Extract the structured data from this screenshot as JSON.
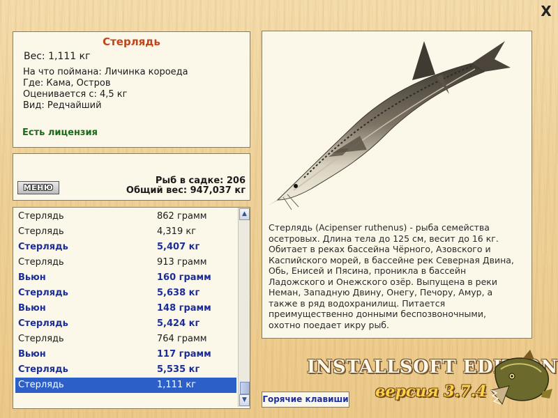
{
  "window": {
    "close_glyph": "X"
  },
  "info": {
    "title": "Стерлядь",
    "weight": "Вес: 1,111 кг",
    "caught_on": "На что поймана: Личинка короеда",
    "location": "Где: Кама, Остров",
    "rated_from": "Оценивается с: 4,5 кг",
    "species_status": "Вид: Редчайший",
    "license": "Есть лицензия"
  },
  "stats": {
    "menu_label": "МЕНЮ",
    "fish_count": "Рыб в садке: 206",
    "total_weight": "Общий вес: 947,037 кг"
  },
  "catch_list": [
    {
      "name": "Стерлядь",
      "weight": "862 грамм",
      "highlight": false
    },
    {
      "name": "Стерлядь",
      "weight": "4,319 кг",
      "highlight": false
    },
    {
      "name": "Стерлядь",
      "weight": "5,407 кг",
      "highlight": true
    },
    {
      "name": "Стерлядь",
      "weight": "913 грамм",
      "highlight": false
    },
    {
      "name": "Вьюн",
      "weight": "160 грамм",
      "highlight": true
    },
    {
      "name": "Стерлядь",
      "weight": "5,638 кг",
      "highlight": true
    },
    {
      "name": "Вьюн",
      "weight": "148 грамм",
      "highlight": true
    },
    {
      "name": "Стерлядь",
      "weight": "5,424 кг",
      "highlight": true
    },
    {
      "name": "Стерлядь",
      "weight": "764 грамм",
      "highlight": false
    },
    {
      "name": "Вьюн",
      "weight": "117 грамм",
      "highlight": true
    },
    {
      "name": "Стерлядь",
      "weight": "5,535 кг",
      "highlight": true
    },
    {
      "name": "Стерлядь",
      "weight": "1,111 кг",
      "highlight": false,
      "selected": true
    }
  ],
  "description": "Стерлядь (Acipenser ruthenus) - рыба семейства осетровых. Длина тела до 125 см, весит до 16 кг. Обитает в реках бассейна Чёрного, Азовского и Каспийского морей, в бассейне рек Северная Двина, Обь, Енисей и Пясина, проникла в бассейн Ладожского и Онежского озёр. Выпущена в реки Неман, Западную Двину, Онегу, Печору, Амур, а также в ряд водохранилищ. Питается преимущественно донными беспозвоночными, охотно поедает икру рыб.",
  "hotkeys_label": "Горячие клавиши",
  "brand": {
    "edition": "INSTALLSOFT EDITION",
    "version": "версия 3.7.4"
  },
  "icons": {
    "close": "close-icon",
    "scroll_up": "scroll-up-icon",
    "scroll_down": "scroll-down-icon",
    "fish_picture": "sterlet-fish-image",
    "logo": "pike-logo"
  },
  "colors": {
    "title": "#c0451b",
    "license": "#1b6b1b",
    "highlight_text": "#1a2d99",
    "selection": "#2d5fc9",
    "version": "#ffd04a"
  }
}
